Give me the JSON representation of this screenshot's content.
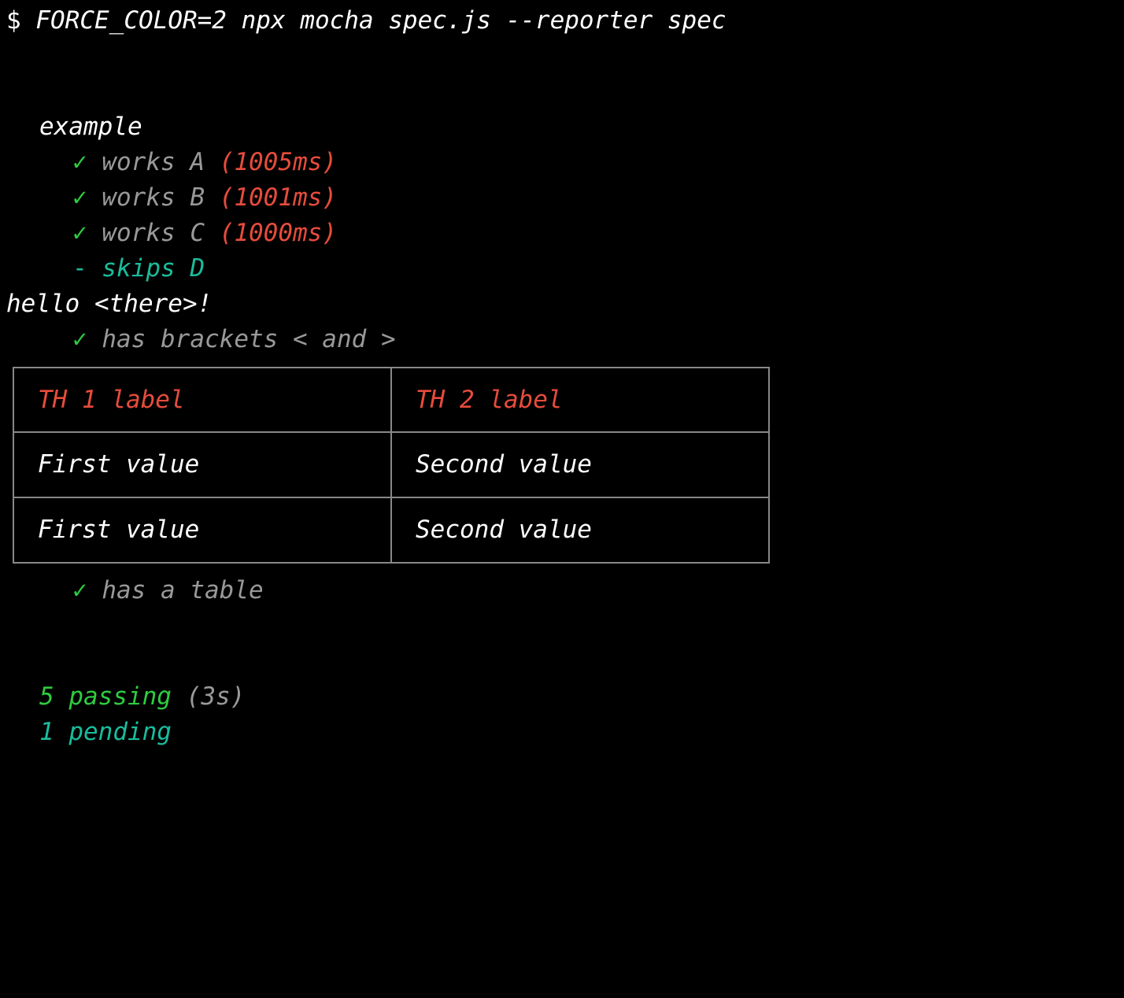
{
  "prompt": {
    "symbol": "$",
    "command": "FORCE_COLOR=2 npx mocha spec.js --reporter spec"
  },
  "suite": {
    "name": "example"
  },
  "tests": [
    {
      "check": "✓",
      "name": "works A",
      "duration": "(1005ms)"
    },
    {
      "check": "✓",
      "name": "works B",
      "duration": "(1001ms)"
    },
    {
      "check": "✓",
      "name": "works C",
      "duration": "(1000ms)"
    }
  ],
  "pending_test": {
    "dash": "-",
    "name": "skips D"
  },
  "stdout_line": "hello <there>!",
  "test_brackets": {
    "check": "✓",
    "name": "has brackets < and >"
  },
  "table": {
    "headers": [
      "TH 1 label",
      "TH 2 label"
    ],
    "rows": [
      [
        "First value",
        "Second value"
      ],
      [
        "First value",
        "Second value"
      ]
    ]
  },
  "test_table": {
    "check": "✓",
    "name": "has a table"
  },
  "summary": {
    "passing_count": "5 passing",
    "time": "(3s)",
    "pending_count": "1 pending"
  }
}
